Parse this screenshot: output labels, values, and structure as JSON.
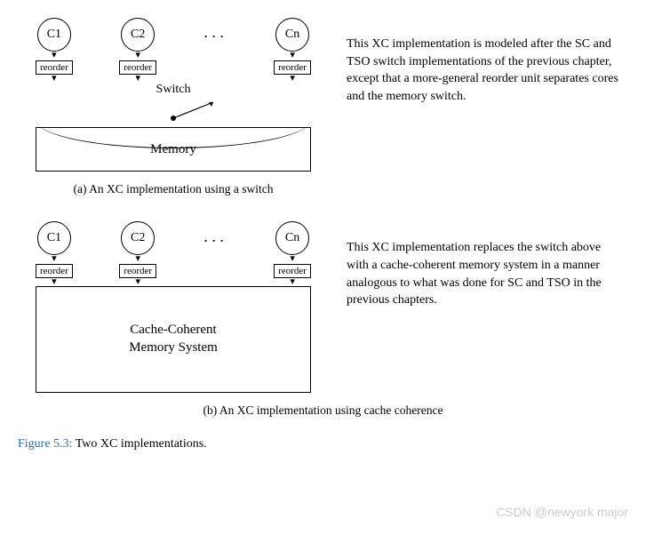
{
  "cores": {
    "c1": "C1",
    "c2": "C2",
    "dots": "···",
    "cn": "Cn",
    "reorder": "reorder"
  },
  "panel_a": {
    "switch_label": "Switch",
    "memory_label": "Memory",
    "caption": "(a) An XC implementation using a switch",
    "desc": "This XC implementation is modeled after the SC and TSO switch implementations of the previous chapter, except that a more-general reorder unit separates cores and the memory switch."
  },
  "panel_b": {
    "box_line1": "Cache-Coherent",
    "box_line2": "Memory System",
    "caption": "(b) An XC implementation using cache coherence",
    "desc": "This XC implementation replaces the switch above with a cache-coherent memory system in a manner analogous to what was done for SC and TSO in the previous chapters."
  },
  "figure": {
    "num": "Figure 5.3:",
    "text": " Two XC implementations."
  },
  "watermark": "CSDN @newyork  major"
}
